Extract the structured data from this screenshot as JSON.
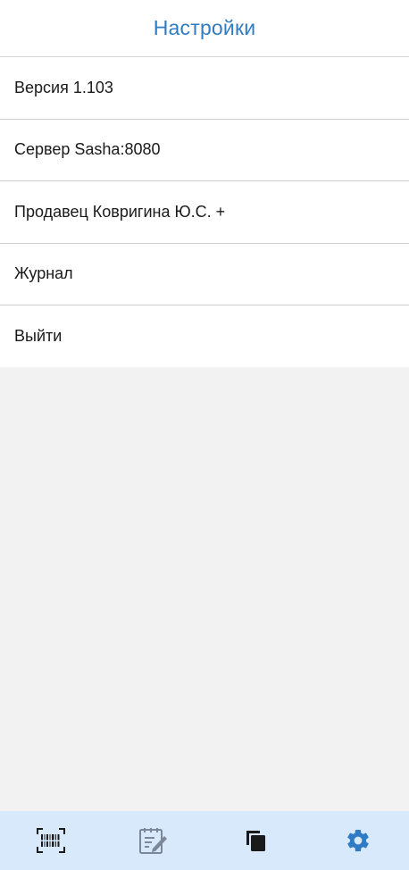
{
  "header": {
    "title": "Настройки"
  },
  "settings": {
    "items": [
      {
        "label": "Версия 1.103"
      },
      {
        "label": "Сервер Sasha:8080"
      },
      {
        "label": "Продавец Ковригина Ю.С. +"
      },
      {
        "label": "Журнал"
      },
      {
        "label": "Выйти"
      }
    ]
  },
  "tabbar": {
    "tabs": [
      {
        "icon": "barcode-scan-icon",
        "active": false
      },
      {
        "icon": "edit-note-icon",
        "active": false
      },
      {
        "icon": "copy-stack-icon",
        "active": false
      },
      {
        "icon": "gear-icon",
        "active": true
      }
    ],
    "colors": {
      "active": "#2f7cc4",
      "inactive": "#1a1a1a",
      "muted": "#7a8899",
      "background": "#d8e9fb"
    }
  },
  "colors": {
    "accent": "#2f7cc4",
    "divider": "#cfcfcf",
    "empty_area": "#f2f2f2"
  }
}
